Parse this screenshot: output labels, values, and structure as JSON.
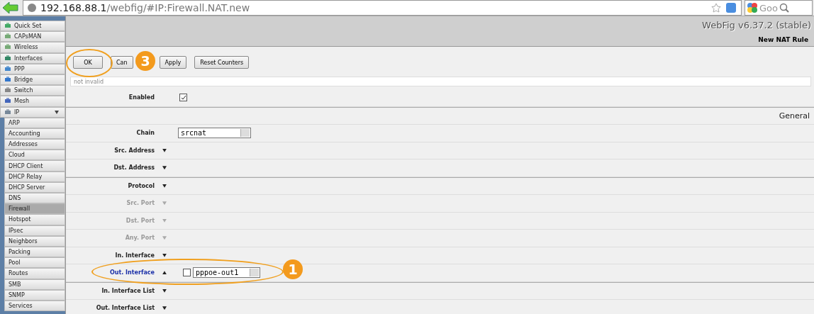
{
  "browser": {
    "url_host": "192.168.88.1",
    "url_path": "/webfig/#IP:Firewall.NAT.new",
    "search_placeholder": "Goo"
  },
  "sidebar": {
    "items": [
      {
        "label": "Quick Set",
        "selected": false
      },
      {
        "label": "CAPsMAN",
        "selected": false
      },
      {
        "label": "Wireless",
        "selected": false
      },
      {
        "label": "Interfaces",
        "selected": false
      },
      {
        "label": "PPP",
        "selected": false
      },
      {
        "label": "Bridge",
        "selected": false
      },
      {
        "label": "Switch",
        "selected": false
      },
      {
        "label": "Mesh",
        "selected": false
      },
      {
        "label": "IP",
        "selected": false,
        "expanded": true,
        "children": [
          {
            "label": "ARP",
            "selected": false
          },
          {
            "label": "Accounting",
            "selected": false
          },
          {
            "label": "Addresses",
            "selected": false
          },
          {
            "label": "Cloud",
            "selected": false
          },
          {
            "label": "DHCP Client",
            "selected": false
          },
          {
            "label": "DHCP Relay",
            "selected": false
          },
          {
            "label": "DHCP Server",
            "selected": false
          },
          {
            "label": "DNS",
            "selected": false
          },
          {
            "label": "Firewall",
            "selected": true
          },
          {
            "label": "Hotspot",
            "selected": false
          },
          {
            "label": "IPsec",
            "selected": false
          },
          {
            "label": "Neighbors",
            "selected": false
          },
          {
            "label": "Packing",
            "selected": false
          },
          {
            "label": "Pool",
            "selected": false
          },
          {
            "label": "Routes",
            "selected": false
          },
          {
            "label": "SMB",
            "selected": false
          },
          {
            "label": "SNMP",
            "selected": false
          },
          {
            "label": "Services",
            "selected": false
          }
        ]
      }
    ]
  },
  "header": {
    "version": "WebFig v6.37.2 (stable)",
    "title": "New NAT Rule"
  },
  "toolbar": {
    "buttons": [
      "OK",
      "Can",
      "Apply",
      "Reset Counters"
    ]
  },
  "status_field": {
    "placeholder": "not invalid"
  },
  "groups": [
    [
      {
        "kind": "checkbox",
        "label": "Enabled",
        "checked": true
      }
    ],
    [
      {
        "kind": "section",
        "title": "General"
      },
      {
        "kind": "select",
        "label": "Chain",
        "value": "srcnat"
      },
      {
        "kind": "toggle",
        "label": "Src. Address",
        "expanded": false,
        "disabled": false,
        "highlighted": false
      },
      {
        "kind": "toggle",
        "label": "Dst. Address",
        "expanded": false,
        "disabled": false,
        "highlighted": false
      }
    ],
    [
      {
        "kind": "toggle",
        "label": "Protocol",
        "expanded": false,
        "disabled": false,
        "highlighted": false
      },
      {
        "kind": "toggle",
        "label": "Src. Port",
        "expanded": false,
        "disabled": true,
        "highlighted": false
      },
      {
        "kind": "toggle",
        "label": "Dst. Port",
        "expanded": false,
        "disabled": true,
        "highlighted": false
      },
      {
        "kind": "toggle",
        "label": "Any. Port",
        "expanded": false,
        "disabled": true,
        "highlighted": false
      },
      {
        "kind": "toggle",
        "label": "In. Interface",
        "expanded": false,
        "disabled": false,
        "highlighted": false
      },
      {
        "kind": "toggle",
        "label": "Out. Interface",
        "expanded": true,
        "disabled": false,
        "highlighted": true,
        "negated": false,
        "value": "pppoe-out1"
      }
    ],
    [
      {
        "kind": "toggle",
        "label": "In. Interface List",
        "expanded": false,
        "disabled": false,
        "highlighted": false
      },
      {
        "kind": "toggle",
        "label": "Out. Interface List",
        "expanded": false,
        "disabled": false,
        "highlighted": false
      }
    ]
  ],
  "annotations": [
    {
      "label": "3"
    },
    {
      "label": "1"
    }
  ]
}
